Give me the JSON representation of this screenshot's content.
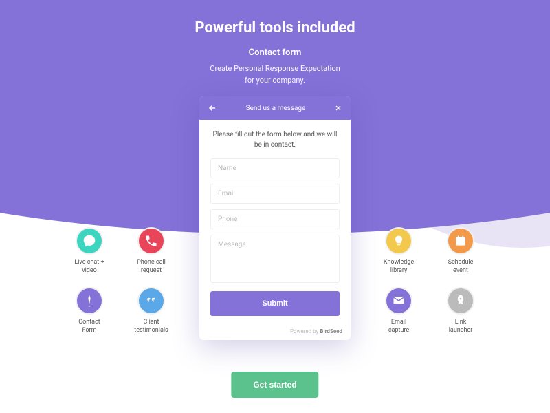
{
  "hero": {
    "title": "Powerful tools included",
    "subtitle": "Contact form",
    "description1": "Create Personal Response Expectation",
    "description2": "for your company."
  },
  "card": {
    "header": "Send us a message",
    "instruction": "Please fill out the form below and we will be in contact.",
    "name_placeholder": "Name",
    "email_placeholder": "Email",
    "phone_placeholder": "Phone",
    "message_placeholder": "Message",
    "submit": "Submit",
    "powered_prefix": "Powered by ",
    "powered_brand": "BirdSeed"
  },
  "tools_left": [
    {
      "label": "Live chat + video",
      "color": "#3dd4c0",
      "icon": "chat"
    },
    {
      "label": "Phone call request",
      "color": "#e8445a",
      "icon": "phone"
    },
    {
      "label": "Contact Form",
      "color": "#8472d8",
      "icon": "pen"
    },
    {
      "label": "Client testimonials",
      "color": "#5aa8e8",
      "icon": "quote"
    }
  ],
  "tools_right": [
    {
      "label": "Knowledge library",
      "color": "#f2c94c",
      "icon": "bulb"
    },
    {
      "label": "Schedule event",
      "color": "#f2994a",
      "icon": "calendar"
    },
    {
      "label": "Email capture",
      "color": "#8472d8",
      "icon": "mail"
    },
    {
      "label": "Link launcher",
      "color": "#bbbbbb",
      "icon": "rocket"
    }
  ],
  "cta": "Get started"
}
